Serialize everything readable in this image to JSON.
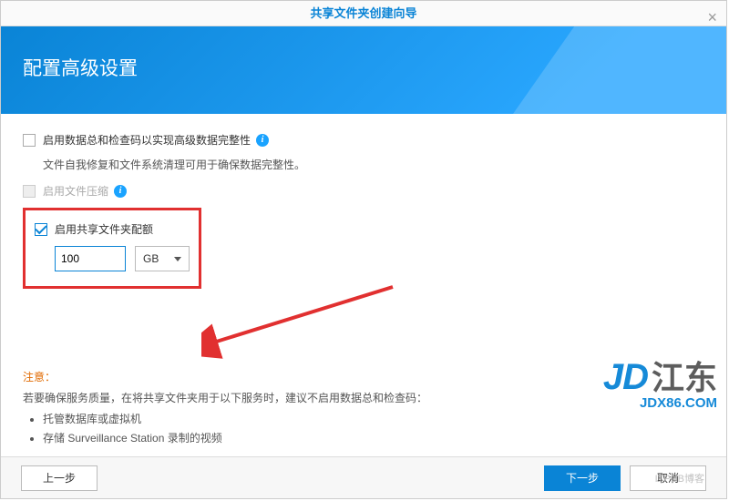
{
  "window": {
    "title": "共享文件夹创建向导",
    "close": "×"
  },
  "header": {
    "heading": "配置高级设置"
  },
  "options": {
    "checksum": {
      "checked": false,
      "label": "启用数据总和检查码以实现高级数据完整性",
      "hint": "文件自我修复和文件系统清理可用于确保数据完整性。"
    },
    "compression": {
      "disabled": true,
      "label": "启用文件压缩"
    },
    "quota": {
      "checked": true,
      "label": "启用共享文件夹配额",
      "value": "100",
      "unit": "GB"
    }
  },
  "notice": {
    "title": "注意：",
    "line": "若要确保服务质量，在将共享文件夹用于以下服务时，建议不启用数据总和检查码：",
    "items": [
      "托管数据库或虚拟机",
      "存储 Surveillance Station 录制的视频"
    ]
  },
  "footer": {
    "prev": "上一步",
    "next": "下一步",
    "cancel": "取消"
  },
  "watermark": {
    "logo": "JD",
    "cn": "江东",
    "site": "JDX86.COM",
    "small": "ITPUB博客"
  },
  "icons": {
    "info": "i"
  }
}
